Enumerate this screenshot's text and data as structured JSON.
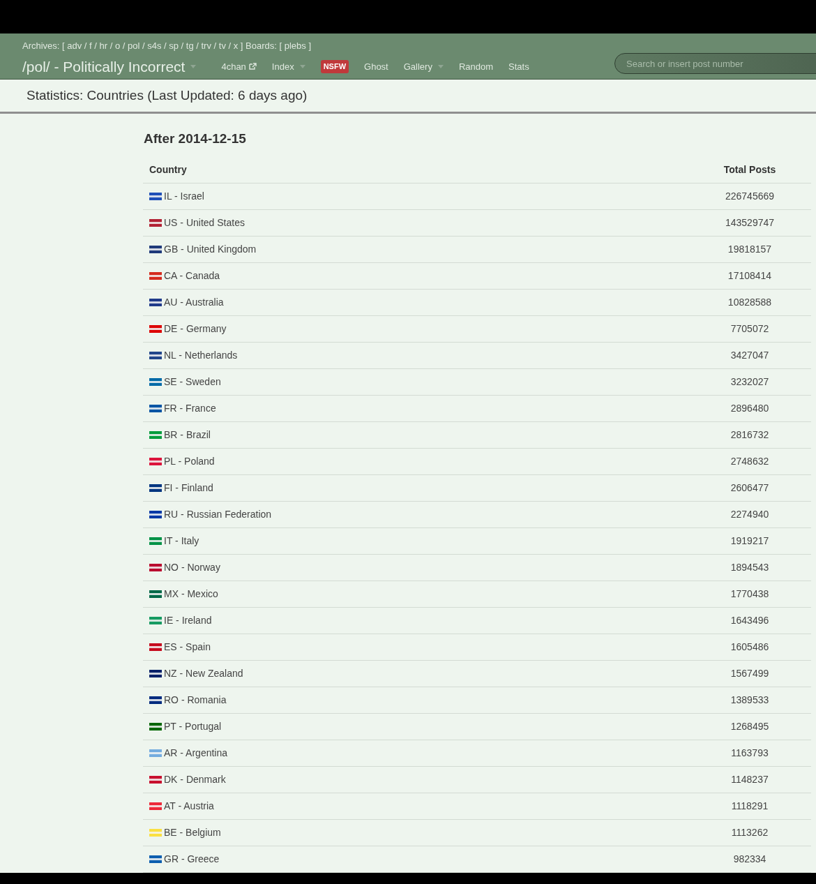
{
  "archives_line": "Archives: [ adv / f / hr / o / pol / s4s / sp / tg / trv / tv / x ] Boards: [ plebs ]",
  "board_title": "/pol/ - Politically Incorrect",
  "nav": [
    {
      "label": "4chan",
      "kind": "external"
    },
    {
      "label": "Index",
      "kind": "dropdown"
    },
    {
      "label": "NSFW",
      "kind": "badge"
    },
    {
      "label": "Ghost",
      "kind": "link"
    },
    {
      "label": "Gallery",
      "kind": "dropdown"
    },
    {
      "label": "Random",
      "kind": "link"
    },
    {
      "label": "Stats",
      "kind": "link"
    }
  ],
  "search": {
    "placeholder": "Search or insert post number"
  },
  "page_title": "Statistics: Countries (Last Updated: 6 days ago)",
  "section_title": "After 2014-12-15",
  "table": {
    "columns": [
      "Country",
      "Total Posts"
    ],
    "rows": [
      {
        "country": "IL - Israel",
        "posts": "226745669",
        "color": "#1f4fb8"
      },
      {
        "country": "US - United States",
        "posts": "143529747",
        "color": "#b22234"
      },
      {
        "country": "GB - United Kingdom",
        "posts": "19818157",
        "color": "#1f3a7a"
      },
      {
        "country": "CA - Canada",
        "posts": "17108414",
        "color": "#d52b1e"
      },
      {
        "country": "AU - Australia",
        "posts": "10828588",
        "color": "#1f3a8a"
      },
      {
        "country": "DE - Germany",
        "posts": "7705072",
        "color": "#dd0000"
      },
      {
        "country": "NL - Netherlands",
        "posts": "3427047",
        "color": "#21468b"
      },
      {
        "country": "SE - Sweden",
        "posts": "3232027",
        "color": "#006aa7"
      },
      {
        "country": "FR - France",
        "posts": "2896480",
        "color": "#0055a4"
      },
      {
        "country": "BR - Brazil",
        "posts": "2816732",
        "color": "#009c3b"
      },
      {
        "country": "PL - Poland",
        "posts": "2748632",
        "color": "#dc143c"
      },
      {
        "country": "FI - Finland",
        "posts": "2606477",
        "color": "#003580"
      },
      {
        "country": "RU - Russian Federation",
        "posts": "2274940",
        "color": "#0039a6"
      },
      {
        "country": "IT - Italy",
        "posts": "1919217",
        "color": "#009246"
      },
      {
        "country": "NO - Norway",
        "posts": "1894543",
        "color": "#ba0c2f"
      },
      {
        "country": "MX - Mexico",
        "posts": "1770438",
        "color": "#006847"
      },
      {
        "country": "IE - Ireland",
        "posts": "1643496",
        "color": "#169b62"
      },
      {
        "country": "ES - Spain",
        "posts": "1605486",
        "color": "#c60b1e"
      },
      {
        "country": "NZ - New Zealand",
        "posts": "1567499",
        "color": "#012169"
      },
      {
        "country": "RO - Romania",
        "posts": "1389533",
        "color": "#002b7f"
      },
      {
        "country": "PT - Portugal",
        "posts": "1268495",
        "color": "#006600"
      },
      {
        "country": "AR - Argentina",
        "posts": "1163793",
        "color": "#74acdf"
      },
      {
        "country": "DK - Denmark",
        "posts": "1148237",
        "color": "#c8102e"
      },
      {
        "country": "AT - Austria",
        "posts": "1118291",
        "color": "#ed2939"
      },
      {
        "country": "BE - Belgium",
        "posts": "1113262",
        "color": "#fae042"
      },
      {
        "country": "GR - Greece",
        "posts": "982334",
        "color": "#0d5eaf"
      }
    ]
  }
}
